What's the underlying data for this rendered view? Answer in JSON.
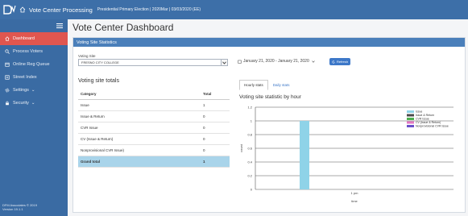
{
  "header": {
    "app_name": "Vote Center Processing",
    "subtitle": "Presidential Primary Election | 2020Mar | 03/03/2020 (EE)"
  },
  "sidebar": {
    "items": [
      {
        "label": "Dashboard",
        "icon": "home-icon",
        "active": true
      },
      {
        "label": "Process Voters",
        "icon": "search-icon"
      },
      {
        "label": "Online Reg Queue",
        "icon": "calendar-icon"
      },
      {
        "label": "Street Index",
        "icon": "list-icon"
      },
      {
        "label": "Settings",
        "icon": "gear-icon",
        "caret": "⌄"
      },
      {
        "label": "Security",
        "icon": "lock-icon",
        "caret": "⌄"
      }
    ],
    "footer_line1": "DFM Associates © 2019",
    "footer_line2": "Version 19.1.1"
  },
  "main": {
    "title": "Vote Center Dashboard",
    "panel_title": "Voting Site Statistics",
    "voting_site_label": "Voting Site",
    "voting_site_value": "FRESNO CITY COLLEGE",
    "date_range": "January 21, 2020 - January 21, 2020",
    "refresh_label": "Refresh",
    "totals_title": "Voting site totals",
    "table": {
      "headers": [
        "Category",
        "Total"
      ],
      "rows": [
        [
          "Issue",
          "1"
        ],
        [
          "Issue & Return",
          "0"
        ],
        [
          "CVR Issue",
          "0"
        ],
        [
          "CV (Issue & Return)",
          "0"
        ],
        [
          "Nonprovisional CVR Issue)",
          "0"
        ],
        [
          "Grand total",
          "1"
        ]
      ]
    },
    "tabs": [
      "Hourly stats",
      "Daily stats"
    ],
    "chart_title": "Voting site statistic by hour"
  },
  "chart_data": {
    "type": "bar",
    "categories": [
      "1 pm"
    ],
    "series": [
      {
        "name": "Issue",
        "values": [
          1
        ],
        "color": "#8fd3e8"
      },
      {
        "name": "Issue & Return",
        "values": [
          0
        ],
        "color": "#4a4a4a"
      },
      {
        "name": "CVR Issue",
        "values": [
          0
        ],
        "color": "#4caf50"
      },
      {
        "name": "CV (Issue & Return)",
        "values": [
          0
        ],
        "color": "#e377c2"
      },
      {
        "name": "Nonprovisional CVR Issue",
        "values": [
          0
        ],
        "color": "#6a4fc9"
      }
    ],
    "yticks": [
      "0",
      "0.2",
      "0.4",
      "0.6",
      "0.8",
      "1",
      "1.2"
    ],
    "ylim": [
      0,
      1.2
    ],
    "xlabel": "time",
    "ylabel": "count",
    "legend": "top-right"
  }
}
